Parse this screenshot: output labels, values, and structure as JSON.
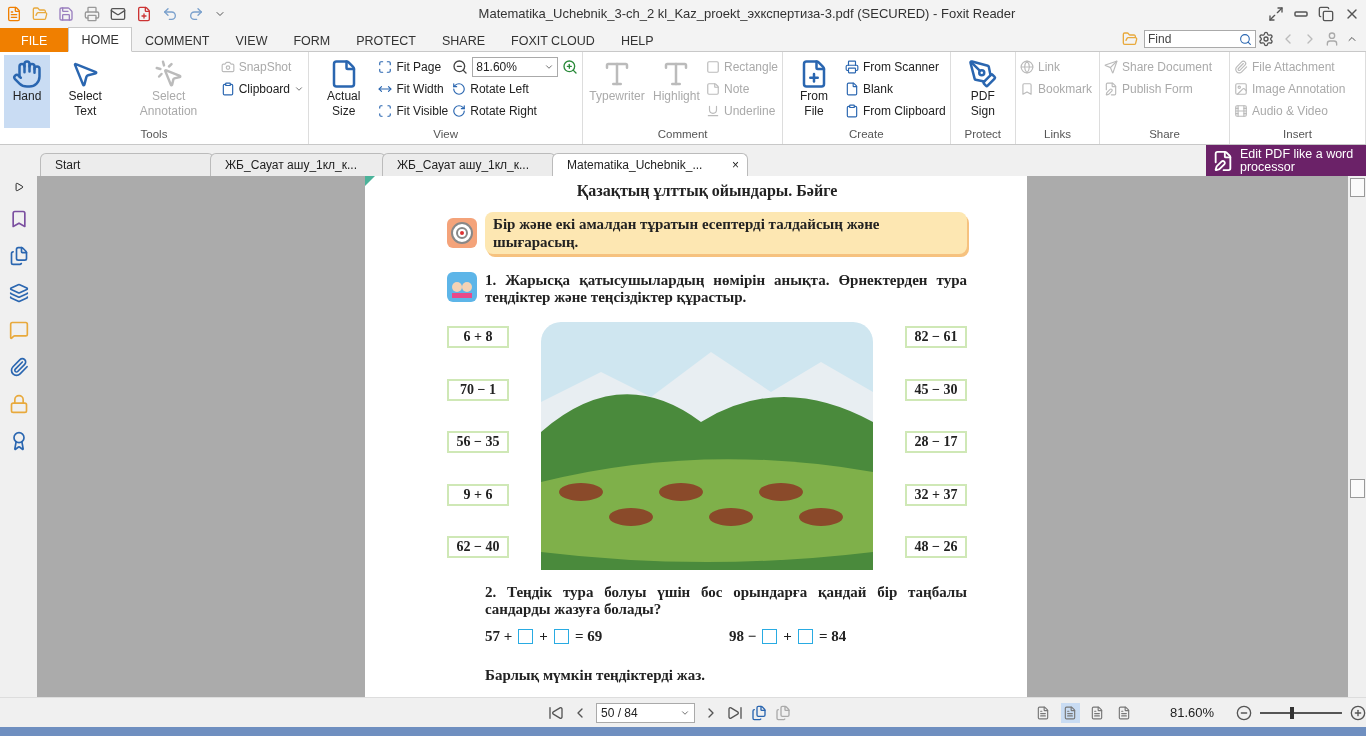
{
  "window": {
    "title": "Matematika_Uchebnik_3-ch_2 kl_Kaz_proekt_эхкспертиза-3.pdf (SECURED) - Foxit Reader"
  },
  "ribbon_tabs": [
    {
      "label": "FILE",
      "kind": "file",
      "selected": false
    },
    {
      "label": "HOME",
      "kind": "tab",
      "selected": true
    },
    {
      "label": "COMMENT",
      "kind": "tab",
      "selected": false
    },
    {
      "label": "VIEW",
      "kind": "tab",
      "selected": false
    },
    {
      "label": "FORM",
      "kind": "tab",
      "selected": false
    },
    {
      "label": "PROTECT",
      "kind": "tab",
      "selected": false
    },
    {
      "label": "SHARE",
      "kind": "tab",
      "selected": false
    },
    {
      "label": "FOXIT CLOUD",
      "kind": "tab",
      "selected": false
    },
    {
      "label": "HELP",
      "kind": "tab",
      "selected": false
    }
  ],
  "find": {
    "placeholder": "Find"
  },
  "ribbon": {
    "groups": [
      {
        "label": "Tools",
        "items": [
          {
            "label": "Hand",
            "kind": "large",
            "disabled": false,
            "selected": true
          },
          {
            "label": "Select Text",
            "kind": "large",
            "disabled": false,
            "selected": false
          },
          {
            "label": "Select Annotation",
            "kind": "large",
            "disabled": true,
            "selected": false
          },
          {
            "label": "SnapShot",
            "kind": "small",
            "disabled": true
          },
          {
            "label": "Clipboard",
            "kind": "menu",
            "disabled": false
          }
        ]
      },
      {
        "label": "View",
        "items": [
          {
            "label": "Actual Size",
            "kind": "large",
            "disabled": false,
            "selected": false
          },
          {
            "label": "Fit Page",
            "kind": "small",
            "disabled": false
          },
          {
            "label": "Fit Width",
            "kind": "small",
            "disabled": false
          },
          {
            "label": "Fit Visible",
            "kind": "small",
            "disabled": false
          },
          {
            "label": "81.60%",
            "kind": "combo"
          },
          {
            "label": "Rotate Left",
            "kind": "small",
            "disabled": false
          },
          {
            "label": "Rotate Right",
            "kind": "small",
            "disabled": false
          }
        ]
      },
      {
        "label": "Comment",
        "items": [
          {
            "label": "Typewriter",
            "kind": "large",
            "disabled": true,
            "selected": false
          },
          {
            "label": "Highlight",
            "kind": "large",
            "disabled": true,
            "selected": false
          },
          {
            "label": "Rectangle",
            "kind": "small",
            "disabled": true
          },
          {
            "label": "Note",
            "kind": "small",
            "disabled": true
          },
          {
            "label": "Underline",
            "kind": "small",
            "disabled": true
          }
        ]
      },
      {
        "label": "Create",
        "items": [
          {
            "label": "From File",
            "kind": "large",
            "disabled": false,
            "selected": false
          },
          {
            "label": "From Scanner",
            "kind": "small",
            "disabled": false
          },
          {
            "label": "Blank",
            "kind": "small",
            "disabled": false
          },
          {
            "label": "From Clipboard",
            "kind": "small",
            "disabled": false
          }
        ]
      },
      {
        "label": "Protect",
        "items": [
          {
            "label": "PDF Sign",
            "kind": "large",
            "disabled": false,
            "selected": false
          }
        ]
      },
      {
        "label": "Links",
        "items": [
          {
            "label": "Link",
            "kind": "small",
            "disabled": true
          },
          {
            "label": "Bookmark",
            "kind": "small",
            "disabled": true
          }
        ]
      },
      {
        "label": "Share",
        "items": [
          {
            "label": "Share Document",
            "kind": "small",
            "disabled": true
          },
          {
            "label": "Publish Form",
            "kind": "small",
            "disabled": true
          }
        ]
      },
      {
        "label": "Insert",
        "items": [
          {
            "label": "File Attachment",
            "kind": "small",
            "disabled": true
          },
          {
            "label": "Image Annotation",
            "kind": "small",
            "disabled": true
          },
          {
            "label": "Audio & Video",
            "kind": "small",
            "disabled": true
          }
        ]
      }
    ]
  },
  "doc_tabs": [
    {
      "label": "Start",
      "selected": false
    },
    {
      "label": "ЖБ_Сауат ашу_1кл_к...",
      "selected": false
    },
    {
      "label": "ЖБ_Сауат ашу_1кл_к...",
      "selected": false
    },
    {
      "label": "Matematika_Uchebnik_...",
      "selected": true,
      "close": "×"
    }
  ],
  "promo": {
    "text": "Edit PDF like a word processor"
  },
  "page": {
    "heading": "Қазақтың ұлттық ойындары. Бәйге",
    "goal": "Бір және екі амалдан тұратын есептерді талдайсың және шығарасың.",
    "task1": "1. Жарысқа қатысушылардың нөмірін анықта. Өрнектерден тура теңдіктер және теңсіздіктер құрастыр.",
    "left_expressions": [
      "6 + 8",
      "70 − 1",
      "56 − 35",
      "9 + 6",
      "62 − 40"
    ],
    "right_expressions": [
      "82 − 61",
      "45 − 30",
      "28 − 17",
      "32 + 37",
      "48 − 26"
    ],
    "task2": "2. Теңдік тура болуы үшін бос орындарға қандай бір таңбалы сандарды жазуға болады?",
    "equations": [
      [
        {
          "kind": "text",
          "text": "57 +"
        },
        {
          "kind": "blank"
        },
        {
          "kind": "text",
          "text": "+"
        },
        {
          "kind": "blank"
        },
        {
          "kind": "text",
          "text": "= 69"
        }
      ],
      [
        {
          "kind": "text",
          "text": "98 −"
        },
        {
          "kind": "blank"
        },
        {
          "kind": "text",
          "text": "+"
        },
        {
          "kind": "blank"
        },
        {
          "kind": "text",
          "text": "= 84"
        }
      ]
    ],
    "final": "Барлық мүмкін теңдіктерді жаз."
  },
  "status_bar": {
    "page": "50 / 84",
    "view_modes": [
      {
        "selected": false
      },
      {
        "selected": true
      },
      {
        "selected": false
      },
      {
        "selected": false
      }
    ],
    "zoom": "81.60%",
    "zoom_slider": {
      "level": 0.36
    }
  }
}
